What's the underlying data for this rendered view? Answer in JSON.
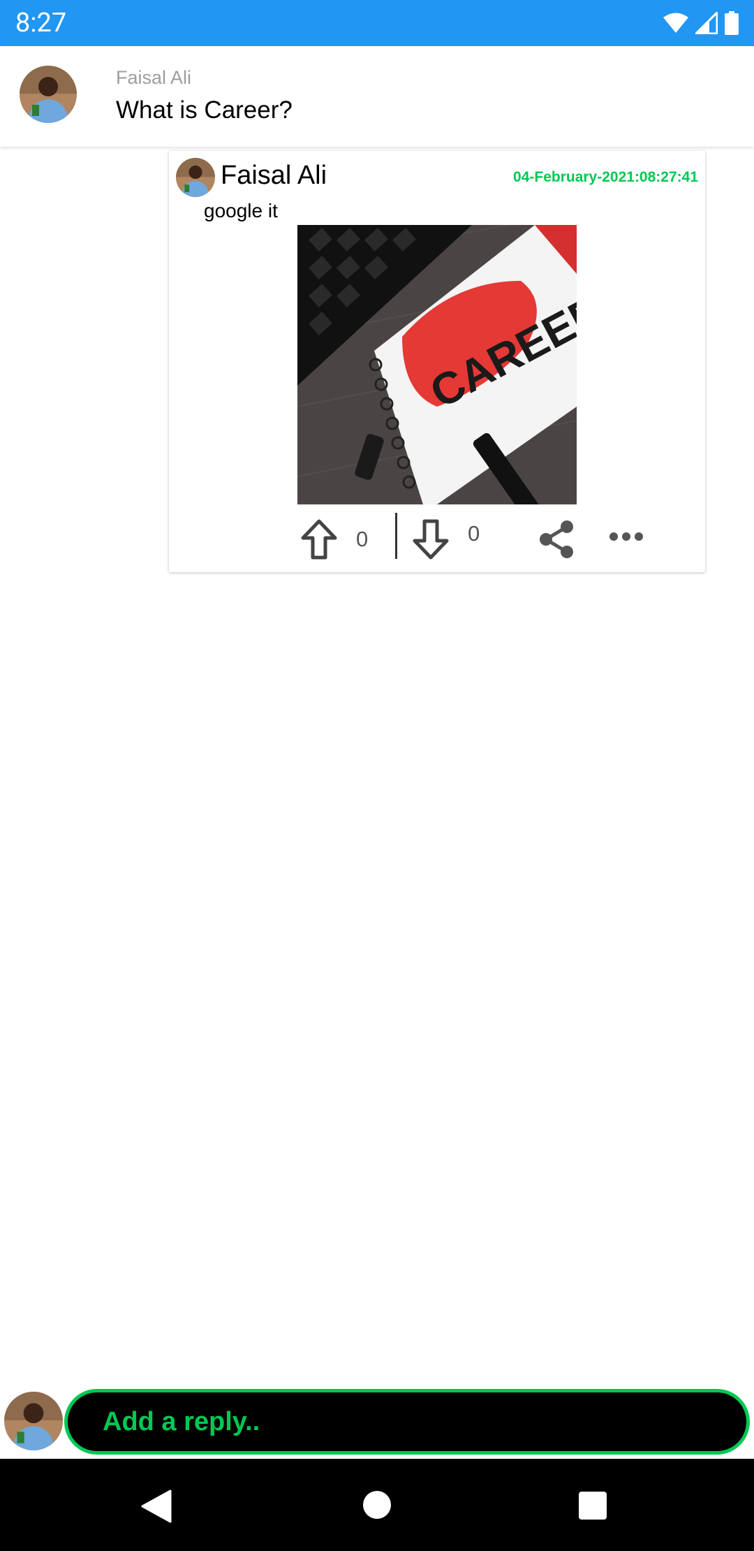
{
  "status_bar": {
    "time": "8:27",
    "icons": [
      "wifi-icon",
      "signal-icon",
      "battery-icon"
    ],
    "bg_color": "#2196F3"
  },
  "question": {
    "author": "Faisal Ali",
    "title": "What is Career?"
  },
  "answer": {
    "author": "Faisal Ali",
    "date": "04-February-2021:08:27:41",
    "text": "google it",
    "image_text": "CAREER!",
    "upvotes": "0",
    "downvotes": "0",
    "date_color": "#00C853"
  },
  "reply": {
    "placeholder": "Add a reply..",
    "accent_color": "#00C853"
  },
  "nav_bar": {
    "icons": [
      "back-icon",
      "home-icon",
      "recents-icon"
    ]
  }
}
